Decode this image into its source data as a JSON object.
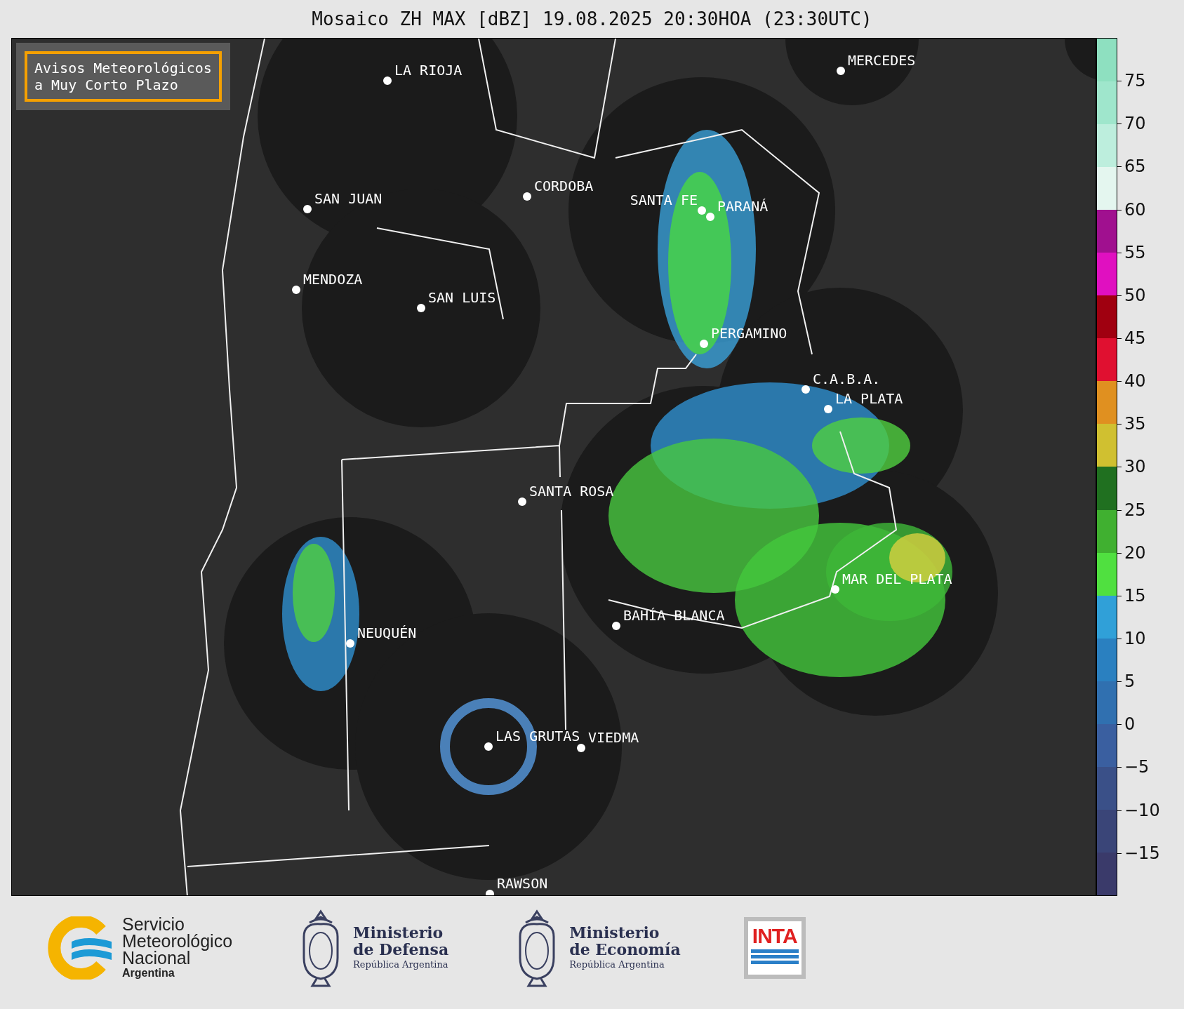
{
  "title": "Mosaico ZH MAX [dBZ] 19.08.2025 20:30HOA (23:30UTC)",
  "notice": {
    "text": "Avisos Meteorológicos\na Muy Corto Plazo"
  },
  "cities": [
    {
      "name": "MERCEDES"
    },
    {
      "name": "LA RIOJA"
    },
    {
      "name": "SAN JUAN"
    },
    {
      "name": "CORDOBA"
    },
    {
      "name": "SANTA FE"
    },
    {
      "name": "PARANÁ"
    },
    {
      "name": "MENDOZA"
    },
    {
      "name": "SAN LUIS"
    },
    {
      "name": "PERGAMINO"
    },
    {
      "name": "C.A.B.A."
    },
    {
      "name": "LA PLATA"
    },
    {
      "name": "SANTA ROSA"
    },
    {
      "name": "MAR DEL PLATA"
    },
    {
      "name": "BAHÍA BLANCA"
    },
    {
      "name": "NEUQUÉN"
    },
    {
      "name": "LAS GRUTAS"
    },
    {
      "name": "VIEDMA"
    },
    {
      "name": "RAWSON"
    }
  ],
  "colorbar": {
    "segments": [
      {
        "color": "#8ee0c0"
      },
      {
        "color": "#9fe6cc"
      },
      {
        "color": "#bdeedd"
      },
      {
        "color": "#e4f6ef"
      },
      {
        "color": "#a0108f"
      },
      {
        "color": "#e010c0"
      },
      {
        "color": "#a00010"
      },
      {
        "color": "#e01030"
      },
      {
        "color": "#e09020"
      },
      {
        "color": "#d0c030"
      },
      {
        "color": "#207020"
      },
      {
        "color": "#40b030"
      },
      {
        "color": "#50e040"
      },
      {
        "color": "#30a0d8"
      },
      {
        "color": "#2a80c0"
      },
      {
        "color": "#3070b0"
      },
      {
        "color": "#3a5fa0"
      },
      {
        "color": "#3a5088"
      },
      {
        "color": "#3a4578"
      },
      {
        "color": "#3a3a6a"
      }
    ],
    "ticks": [
      "75",
      "70",
      "65",
      "60",
      "55",
      "50",
      "45",
      "40",
      "35",
      "30",
      "25",
      "20",
      "15",
      "10",
      "5",
      "0",
      "−5",
      "−10",
      "−15"
    ]
  },
  "logos": [
    {
      "kind": "smn",
      "lines": [
        "Servicio",
        "Meteorológico",
        "Nacional"
      ],
      "sub": "Argentina"
    },
    {
      "kind": "ministry",
      "lines": [
        "Ministerio",
        "de Defensa"
      ],
      "sub": "República Argentina"
    },
    {
      "kind": "ministry",
      "lines": [
        "Ministerio",
        "de Economía"
      ],
      "sub": "República Argentina"
    },
    {
      "kind": "inta",
      "lines": [
        "INTA"
      ]
    }
  ]
}
